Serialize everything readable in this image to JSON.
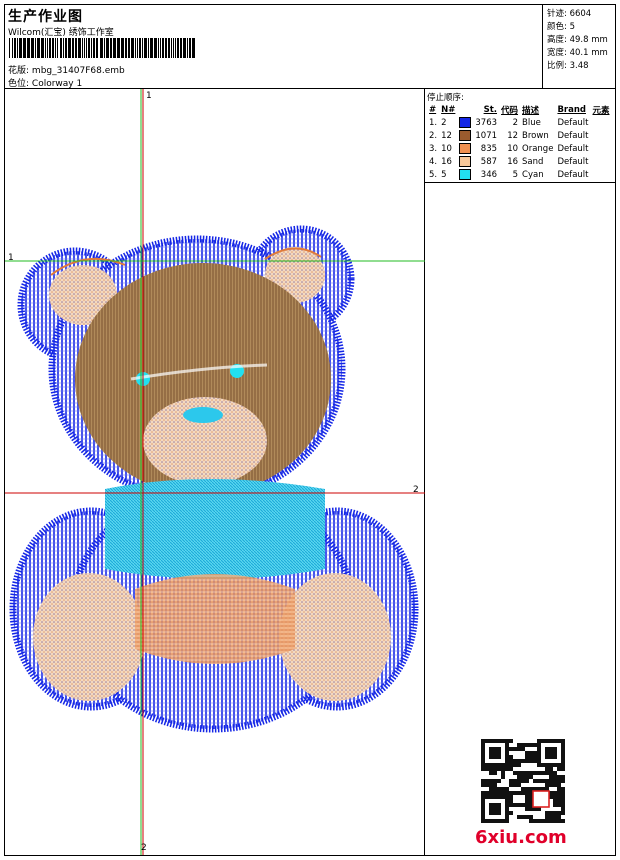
{
  "header": {
    "title": "生产作业图",
    "company": "Wilcom(汇宝) 绣饰工作室",
    "design_label": "花版:",
    "design_value": "mbg_31407F68.emb",
    "colorway_label": "色位:",
    "colorway_value": "Colorway 1"
  },
  "stats": [
    {
      "label": "针迹:",
      "value": "6604"
    },
    {
      "label": "颜色:",
      "value": "5"
    },
    {
      "label": "高度:",
      "value": "49.8 mm"
    },
    {
      "label": "宽度:",
      "value": "40.1 mm"
    },
    {
      "label": "比例:",
      "value": "3.48"
    }
  ],
  "stop_sequence": {
    "title": "停止顺序:",
    "columns": [
      "#",
      "N#",
      "St.",
      "代码",
      "描述",
      "Brand",
      "元素"
    ],
    "rows": [
      {
        "idx": "1.",
        "n": "2",
        "color": "#1426e6",
        "stitches": "3763",
        "code": "2",
        "desc": "Blue",
        "brand": "Default"
      },
      {
        "idx": "2.",
        "n": "12",
        "color": "#9a5b2e",
        "stitches": "1071",
        "code": "12",
        "desc": "Brown",
        "brand": "Default"
      },
      {
        "idx": "3.",
        "n": "10",
        "color": "#f09050",
        "stitches": "835",
        "code": "10",
        "desc": "Orange",
        "brand": "Default"
      },
      {
        "idx": "4.",
        "n": "16",
        "color": "#f8c89a",
        "stitches": "587",
        "code": "16",
        "desc": "Sand",
        "brand": "Default"
      },
      {
        "idx": "5.",
        "n": "5",
        "color": "#22e0f0",
        "stitches": "346",
        "code": "5",
        "desc": "Cyan",
        "brand": "Default"
      }
    ]
  },
  "markers": {
    "one": "1",
    "two": "2"
  },
  "footer": {
    "brand": "6xiu.com"
  }
}
